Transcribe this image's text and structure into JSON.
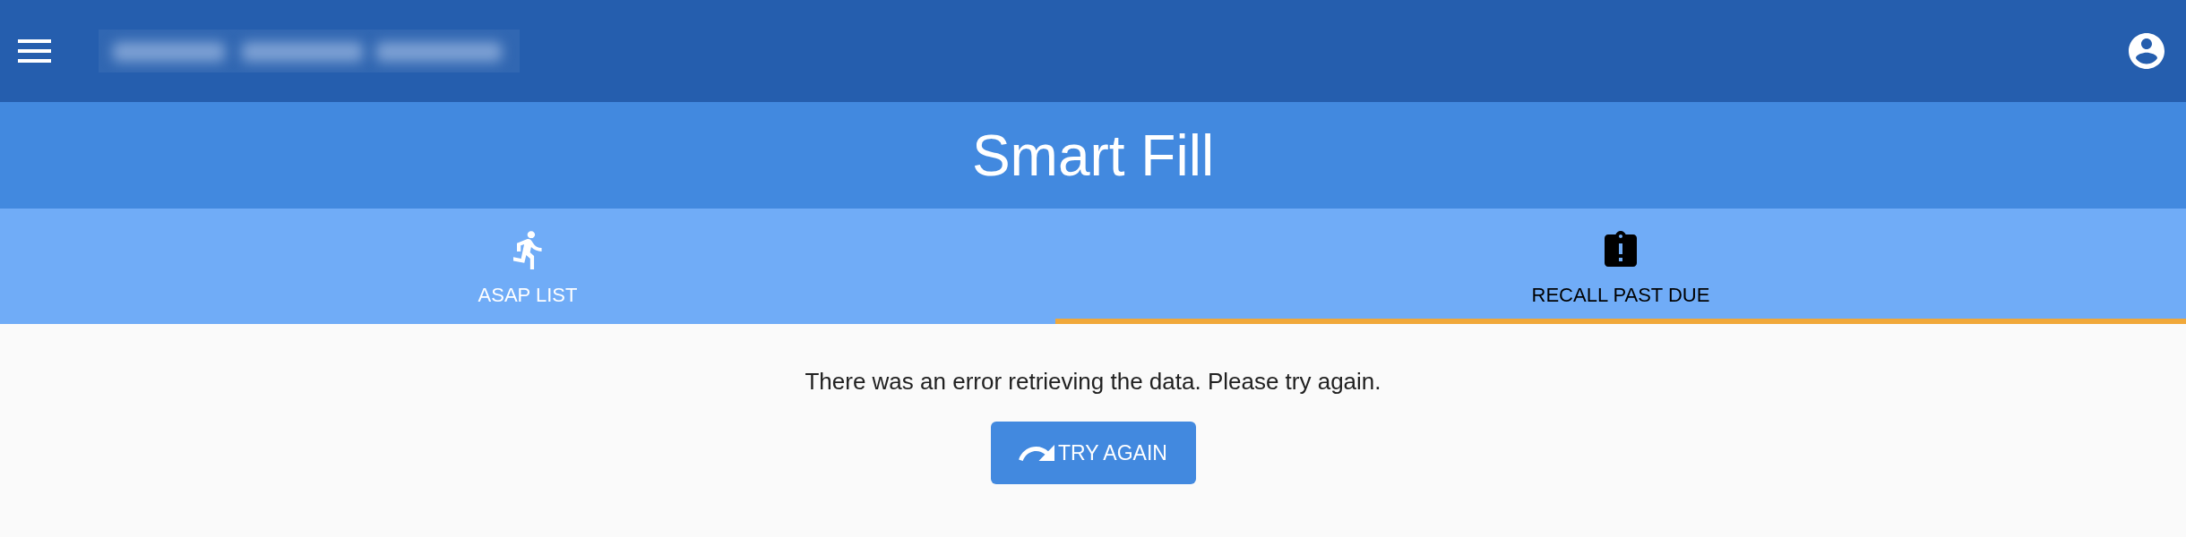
{
  "header": {
    "title": "Smart Fill"
  },
  "tabs": [
    {
      "label": "ASAP LIST",
      "selected": false
    },
    {
      "label": "RECALL PAST DUE",
      "selected": true
    }
  ],
  "message": "There was an error retrieving the data. Please try again.",
  "buttons": [
    {
      "label": "TRY AGAIN"
    }
  ]
}
